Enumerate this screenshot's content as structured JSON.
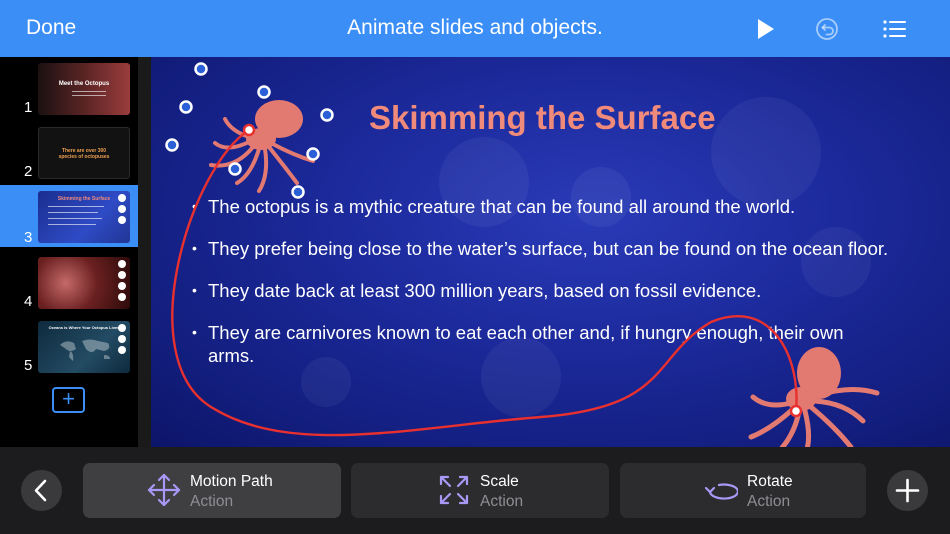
{
  "toolbar": {
    "done_label": "Done",
    "title": "Animate slides and objects.",
    "accent": "#3a8ef5"
  },
  "navigator": {
    "slides": [
      {
        "number": "1",
        "thumb_title": "Meet the Octopus"
      },
      {
        "number": "2",
        "thumb_title": "There are over 300 species of octopuses"
      },
      {
        "number": "3",
        "thumb_title": "Skimming the Surface",
        "selected": true
      },
      {
        "number": "4",
        "thumb_title": ""
      },
      {
        "number": "5",
        "thumb_title": "Oceans is Where Your Octopus Lives"
      }
    ]
  },
  "slide": {
    "title": "Skimming the Surface",
    "title_color": "#f08a7a",
    "bullets": [
      "The octopus is a mythic creature that can be found all around the world.",
      "They prefer being close to the water’s surface, but can be found on the ocean floor.",
      "They date back at least 300 million years, based on fossil evidence.",
      "They are carnivores known to eat each other and, if hungry enough, their own arms."
    ],
    "motion_path_color": "#e8302f"
  },
  "actions": [
    {
      "label": "Motion Path",
      "sub": "Action",
      "icon": "motion-path-icon",
      "selected": true
    },
    {
      "label": "Scale",
      "sub": "Action",
      "icon": "scale-icon"
    },
    {
      "label": "Rotate",
      "sub": "Action",
      "icon": "rotate-icon"
    }
  ]
}
